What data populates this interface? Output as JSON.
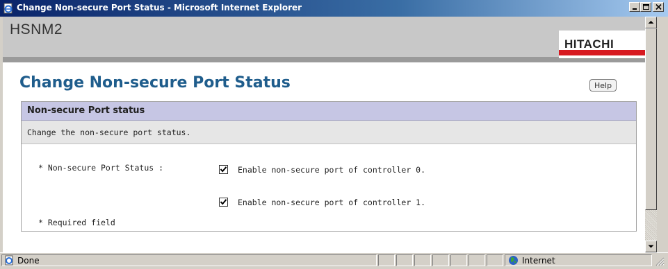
{
  "window": {
    "title": "Change Non-secure Port Status - Microsoft Internet Explorer"
  },
  "header": {
    "app_name": "HSNM2",
    "logo": "HITACHI"
  },
  "page": {
    "title": "Change Non-secure Port Status",
    "help_label": "Help"
  },
  "panel": {
    "heading": "Non-secure Port status",
    "description": "Change the non-secure port status.",
    "field_label": "* Non-secure Port Status :",
    "options": [
      {
        "label": "Enable non-secure port of controller 0.",
        "checked": true
      },
      {
        "label": "Enable non-secure port of controller 1.",
        "checked": true
      }
    ],
    "required_note": "* Required field"
  },
  "statusbar": {
    "status": "Done",
    "zone": "Internet"
  },
  "icons": {
    "app": "ie-page-icon",
    "minimize": "minimize-icon",
    "maximize": "maximize-icon",
    "close": "close-icon",
    "checkbox": "checkmark-icon",
    "zone": "globe-icon",
    "status": "page-done-icon"
  },
  "colors": {
    "titlebar_start": "#0a246a",
    "page_title": "#1f5d8c",
    "panel_header": "#c6c6e4",
    "logo_accent": "#d71920"
  }
}
